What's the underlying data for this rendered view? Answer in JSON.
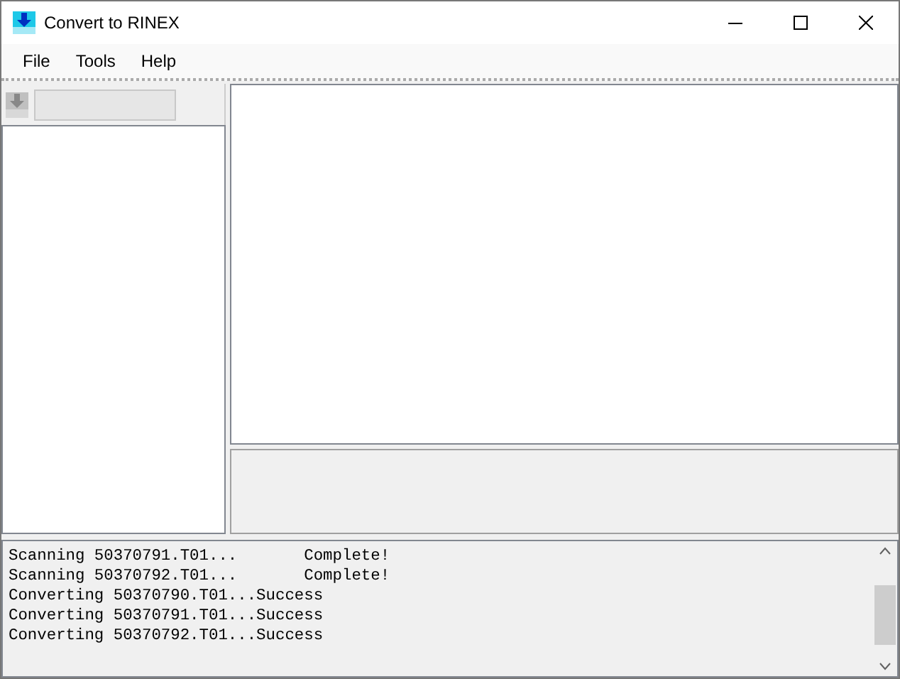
{
  "window": {
    "title": "Convert to RINEX"
  },
  "menu": [
    {
      "label": "File"
    },
    {
      "label": "Tools"
    },
    {
      "label": "Help"
    }
  ],
  "log": {
    "lines": [
      "Scanning 50370791.T01...       Complete!",
      "Scanning 50370792.T01...       Complete!",
      "Converting 50370790.T01...Success",
      "Converting 50370791.T01...Success",
      "Converting 50370792.T01...Success"
    ]
  }
}
